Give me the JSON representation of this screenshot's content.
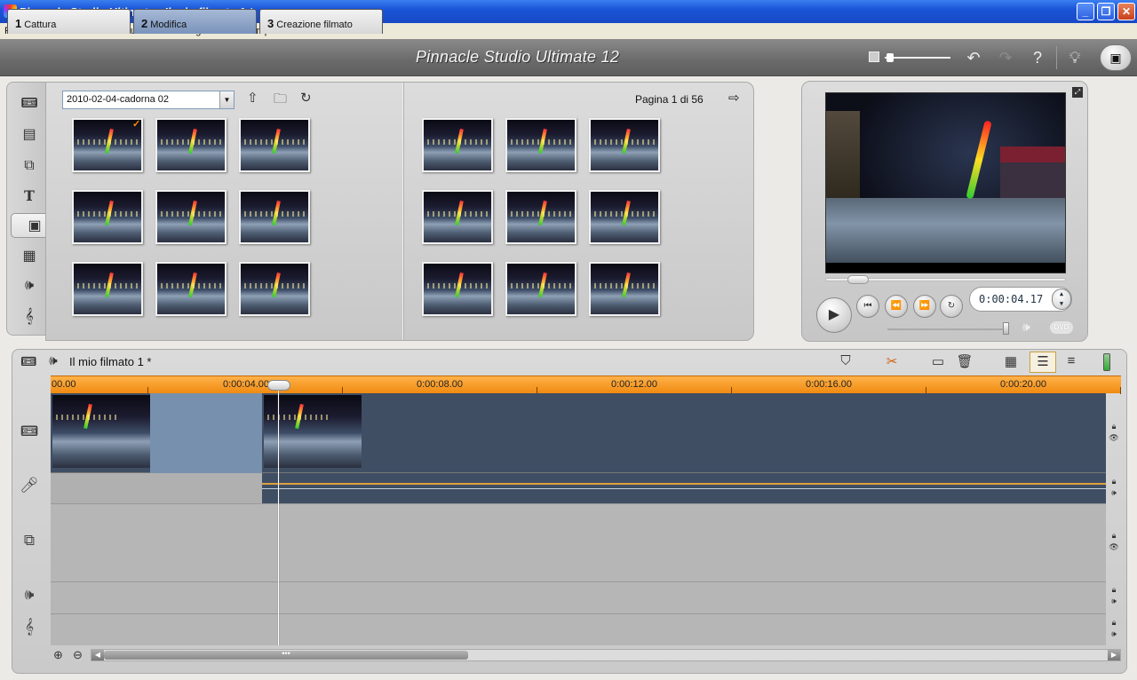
{
  "window": {
    "title": "Pinnacle Studio Ultimate - Il mio filmato 1 *"
  },
  "menu": [
    "File",
    "Modifica",
    "Visualizza",
    "Album",
    "Casella degli strumenti",
    "Impostazioni",
    "Guida"
  ],
  "tabs": [
    {
      "num": "1",
      "label": "Cattura"
    },
    {
      "num": "2",
      "label": "Modifica"
    },
    {
      "num": "3",
      "label": "Creazione filmato"
    }
  ],
  "brand": "Pinnacle Studio Ultimate 12",
  "album": {
    "folder": "2010-02-04-cadorna 02",
    "page_indicator": "Pagina 1 di 56"
  },
  "player": {
    "timecode": "0:00:04.17",
    "dvd_label": "DVD"
  },
  "timeline": {
    "project_title": "Il mio filmato 1 *",
    "ruler_labels": [
      "00.00",
      "0:00:04.00",
      "0:00:08.00",
      "0:00:12.00",
      "0:00:16.00",
      "0:00:20.00"
    ],
    "scroll_grip": "•••"
  }
}
